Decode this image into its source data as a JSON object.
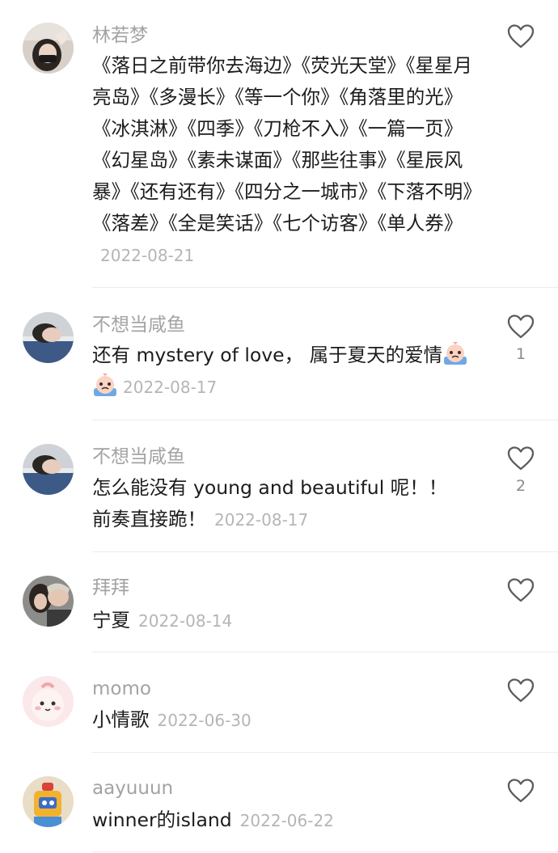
{
  "comments": [
    {
      "username": "林若梦",
      "text": "《落日之前带你去海边》《荧光天堂》《星星月亮岛》《多漫长》《等一个你》《角落里的光》《冰淇淋》《四季》《刀枪不入》《一篇一页》《幻星岛》《素未谋面》《那些往事》《星辰风暴》《还有还有》《四分之一城市》《下落不明》《落差》《全是笑话》《七个访客》《单人券》",
      "date": "2022-08-21",
      "likes": ""
    },
    {
      "username": "不想当咸鱼",
      "text": "还有 mystery of love， 属于夏天的爱情",
      "date": "2022-08-17",
      "likes": "1"
    },
    {
      "username": "不想当咸鱼",
      "text": "怎么能没有 young and beautiful 呢！！ 前奏直接跪！",
      "date": "2022-08-17",
      "likes": "2"
    },
    {
      "username": "拜拜",
      "text": "宁夏",
      "date": "2022-08-14",
      "likes": ""
    },
    {
      "username": "momo",
      "text": "小情歌",
      "date": "2022-06-30",
      "likes": ""
    },
    {
      "username": "aayuuun",
      "text": "winner的island",
      "date": "2022-06-22",
      "likes": ""
    }
  ],
  "icons": {
    "like": "heart-outline-icon",
    "emoji": "crying-face-emoji"
  }
}
